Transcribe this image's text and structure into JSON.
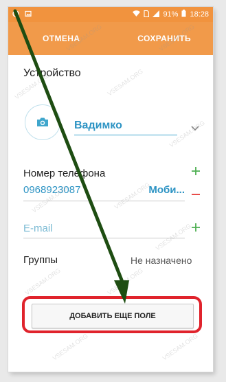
{
  "status_bar": {
    "battery_percent": "91%",
    "time": "18:28"
  },
  "action_bar": {
    "cancel_label": "ОТМЕНА",
    "save_label": "СОХРАНИТЬ"
  },
  "form": {
    "section_title": "Устройство",
    "name_value": "Вадимко",
    "phone_label": "Номер телефона",
    "phone_number": "0968923087",
    "phone_type": "Моби...",
    "email_placeholder": "E-mail",
    "groups_label": "Группы",
    "groups_value": "Не назначено"
  },
  "add_field_button": "ДОБАВИТЬ ЕЩЕ ПОЛЕ",
  "watermark": "VSESAM.ORG",
  "colors": {
    "accent_orange": "#f19a4a",
    "link_blue": "#2e94c4",
    "add_green": "#4caf50",
    "remove_red": "#e53935",
    "highlight_red": "#e0232c",
    "arrow_green": "#1e4d12"
  }
}
